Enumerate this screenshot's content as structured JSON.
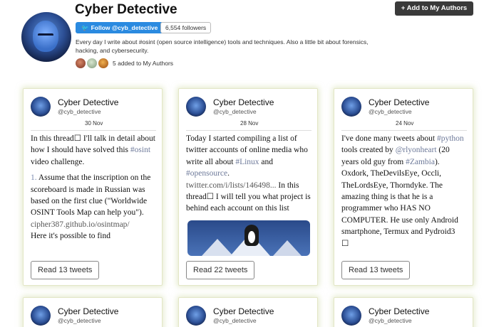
{
  "profile": {
    "name": "Cyber Detective",
    "follow_label": "Follow @cyb_detective",
    "followers": "6,554 followers",
    "bio": "Every day I write about #osint (open source intelligence) tools and techniques. Also a little bit about forensics, hacking, and cybersecurity.",
    "added_text": "5 added to My Authors",
    "add_button": "+ Add to My Authors"
  },
  "cards": [
    {
      "name": "Cyber Detective",
      "handle": "@cyb_detective",
      "date": "30 Nov",
      "read": "Read 13 tweets",
      "text": {
        "p1a": "In this thread",
        "p1b": "☐",
        "p1c": " I'll talk in detail about how I should have solved this ",
        "p1d": "#osint",
        "p1e": " video challenge.",
        "p2a": "1.",
        "p2b": " Assume that the inscription on the scoreboard is made in Russian was based on the first clue (\"Worldwide OSINT Tools Map can help you\").",
        "p2c": "cipher387.github.io/osintmap/",
        "p2d": "Here it's possible to find"
      }
    },
    {
      "name": "Cyber Detective",
      "handle": "@cyb_detective",
      "date": "28 Nov",
      "read": "Read 22 tweets",
      "text": {
        "a": "Today I started compiling a list of twitter accounts of online media who write all about ",
        "b": "#Linux",
        "c": " and ",
        "d": "#opensource",
        "e": ".",
        "f": "twitter.com/i/lists/146498...",
        "g": " In this thread",
        "h": "☐",
        "i": " I will tell you what project is behind each account on this list"
      }
    },
    {
      "name": "Cyber Detective",
      "handle": "@cyb_detective",
      "date": "24 Nov",
      "read": "Read 13 tweets",
      "text": {
        "a": "I've done many tweets about ",
        "b": "#python",
        "c": " tools created by ",
        "d": "@rlyonheart",
        "e": " (20 years old guy from ",
        "f": "#Zambia",
        "g": "). Oxdork, TheDevilsEye, Occli, TheLordsEye, Thorndyke. The amazing thing is that he is a programmer who HAS NO COMPUTER. He use only Android smartphone, Termux and Pydroid3",
        "h": "☐"
      }
    }
  ],
  "row2": [
    {
      "name": "Cyber Detective",
      "handle": "@cyb_detective"
    },
    {
      "name": "Cyber Detective",
      "handle": "@cyb_detective"
    },
    {
      "name": "Cyber Detective",
      "handle": "@cyb_detective"
    }
  ]
}
